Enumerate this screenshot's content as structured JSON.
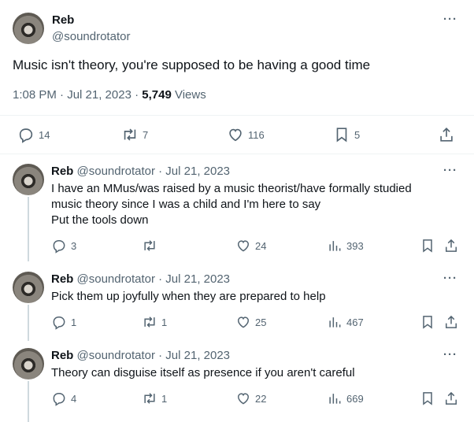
{
  "main": {
    "name": "Reb",
    "handle": "@soundrotator",
    "text": "Music isn't theory, you're supposed to be having a good time",
    "time": "1:08 PM · Jul 21, 2023 · ",
    "views_count": "5,749",
    "views_label": " Views",
    "replies": "14",
    "retweets": "7",
    "likes": "116",
    "bookmarks": "5"
  },
  "replies": [
    {
      "name": "Reb",
      "handle_date": "@soundrotator · Jul 21, 2023",
      "lines": [
        "I have an MMus/was raised by a music theorist/have formally studied",
        "music theory since I was a child and I'm here to say",
        "Put the tools down"
      ],
      "replies": "3",
      "retweets": "",
      "likes": "24",
      "views": "393"
    },
    {
      "name": "Reb",
      "handle_date": "@soundrotator · Jul 21, 2023",
      "lines": [
        "Pick them up joyfully when they are prepared to help"
      ],
      "replies": "1",
      "retweets": "1",
      "likes": "25",
      "views": "467"
    },
    {
      "name": "Reb",
      "handle_date": "@soundrotator · Jul 21, 2023",
      "lines": [
        "Theory can disguise itself as presence if you aren't careful"
      ],
      "replies": "4",
      "retweets": "1",
      "likes": "22",
      "views": "669"
    }
  ],
  "icons": {
    "more": "more-icon",
    "reply": "reply-icon",
    "retweet": "retweet-icon",
    "like": "heart-icon",
    "bookmark": "bookmark-icon",
    "share": "share-icon",
    "views": "views-icon"
  }
}
